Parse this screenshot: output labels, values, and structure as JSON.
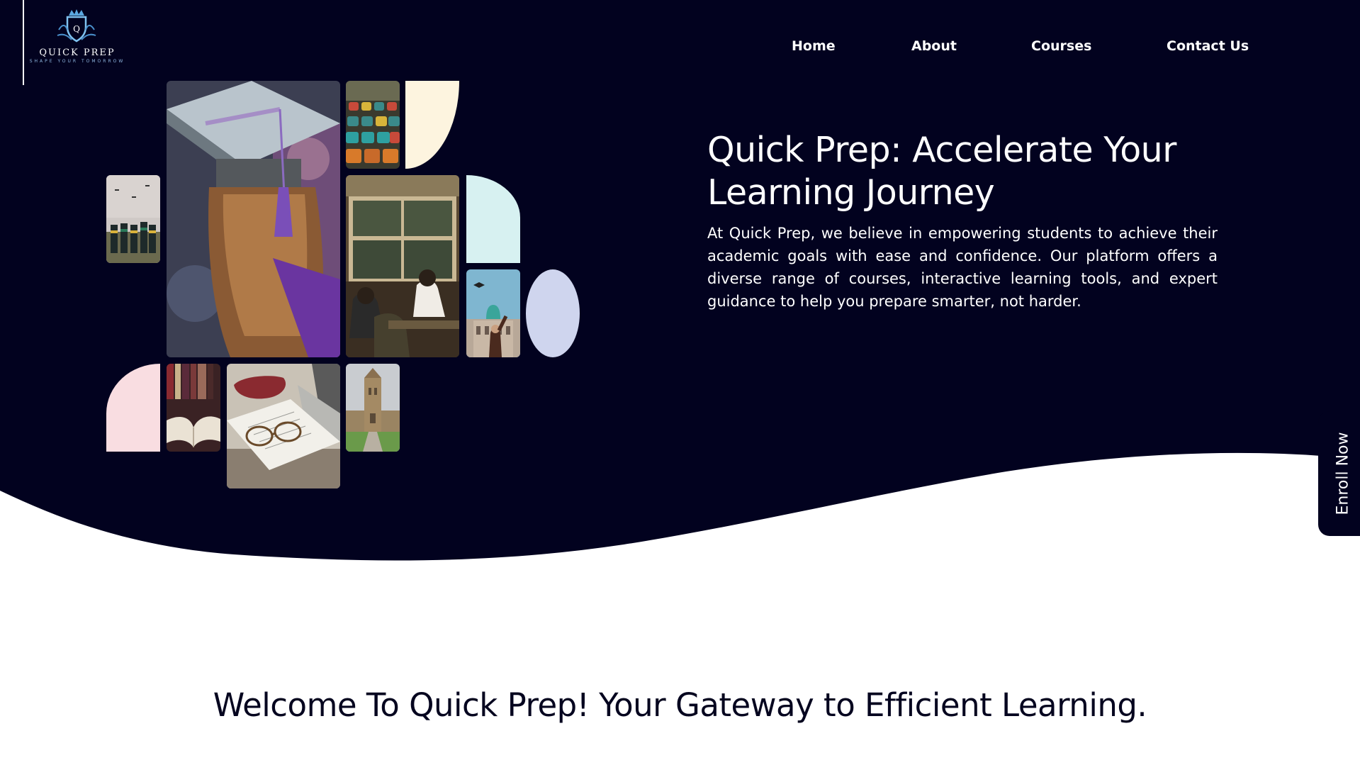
{
  "brand": {
    "name": "QUICK PREP",
    "tagline": "SHAPE YOUR TOMORROW",
    "logo_icon": "crown-shield-icon"
  },
  "nav": {
    "items": [
      {
        "label": "Home"
      },
      {
        "label": "About"
      },
      {
        "label": "Courses"
      },
      {
        "label": "Contact Us"
      }
    ]
  },
  "hero": {
    "title": "Quick Prep: Accelerate Your Learning Journey",
    "description": "At Quick Prep, we believe in empowering students to achieve their academic goals with ease and confidence. Our platform offers a diverse range of courses, interactive learning tools, and expert guidance to help you prepare smarter, not harder."
  },
  "enroll_tab": {
    "label": "Enroll Now"
  },
  "welcome": {
    "heading": "Welcome To Quick Prep! Your Gateway to Efficient Learning."
  },
  "colors": {
    "hero_background": "#02021f",
    "page_background": "#ffffff",
    "shape_cream": "#fdf4df",
    "shape_mint": "#d7f1f1",
    "shape_lavender": "#cfd5ee",
    "shape_pink": "#f9dde1"
  }
}
